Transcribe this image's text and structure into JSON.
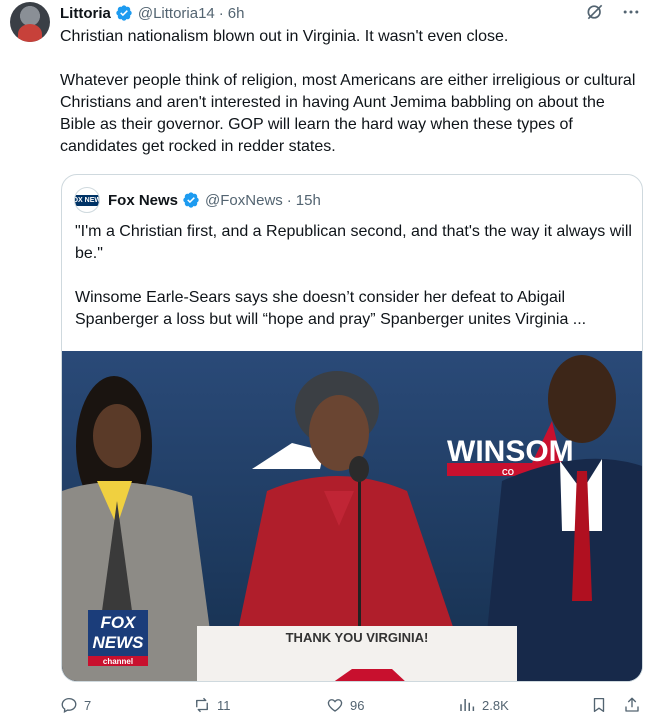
{
  "post": {
    "author_name": "Littoria",
    "handle": "@Littoria14",
    "separator": "·",
    "time": "6h",
    "paragraphs": [
      "Christian nationalism blown out in Virginia. It wasn't even close.",
      "Whatever people think of religion, most Americans are either irreligious or cultural Christians and aren't interested in having Aunt Jemima babbling on about the Bible as their governor. GOP will learn the hard way when these types of candidates get rocked in redder states."
    ]
  },
  "quoted": {
    "author_name": "Fox News",
    "handle": "@FoxNews",
    "separator": "·",
    "time": "15h",
    "avatar_text": "FOX NEWS",
    "paragraphs": [
      "\"I'm a Christian first, and a Republican second, and that's the way it always will be.\"",
      "Winsome Earle-Sears says she doesn’t consider her defeat to Abigail Spanberger a loss but will “hope and pray” Spanberger unites Virginia ..."
    ],
    "media": {
      "banner_text": "THANK YOU VIRGINIA!",
      "sign_text": "WINSOM",
      "sign_subtext": "CO",
      "logo_line1": "FOX",
      "logo_line2": "NEWS",
      "logo_line3": "channel"
    }
  },
  "actions": {
    "replies": "7",
    "reposts": "11",
    "likes": "96",
    "views": "2.8K"
  },
  "colors": {
    "verified_blue": "#1d9bf0",
    "secondary_text": "#536471",
    "fox_red": "#c8102e"
  },
  "icons": [
    "grok-icon",
    "more-icon",
    "verified-badge-icon",
    "reply-icon",
    "repost-icon",
    "like-icon",
    "views-icon",
    "bookmark-icon",
    "share-icon"
  ]
}
